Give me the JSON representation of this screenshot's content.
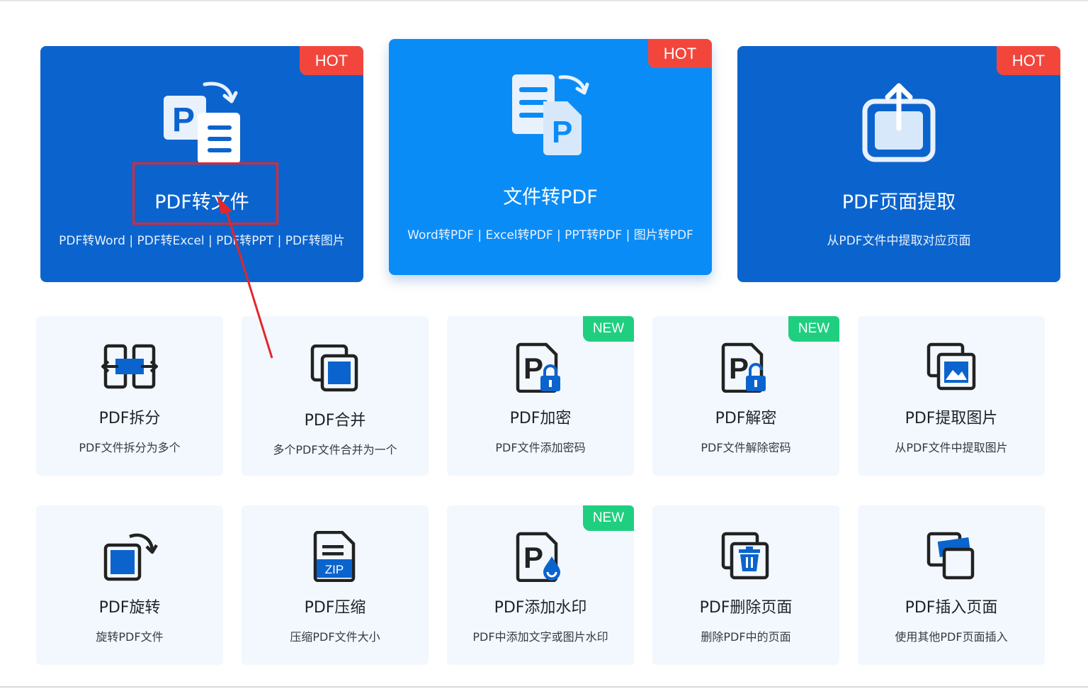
{
  "big_cards": [
    {
      "title": "PDF转文件",
      "subtitle": "PDF转Word | PDF转Excel | PDF转PPT | PDF转图片",
      "badge": "HOT",
      "icon": "pdf-to-file-icon"
    },
    {
      "title": "文件转PDF",
      "subtitle": "Word转PDF | Excel转PDF | PPT转PDF | 图片转PDF",
      "badge": "HOT",
      "icon": "file-to-pdf-icon"
    },
    {
      "title": "PDF页面提取",
      "subtitle": "从PDF文件中提取对应页面",
      "badge": "HOT",
      "icon": "page-extract-icon"
    }
  ],
  "tools_row1": [
    {
      "title": "PDF拆分",
      "subtitle": "PDF文件拆分为多个",
      "icon": "split-icon"
    },
    {
      "title": "PDF合并",
      "subtitle": "多个PDF文件合并为一个",
      "icon": "merge-icon"
    },
    {
      "title": "PDF加密",
      "subtitle": "PDF文件添加密码",
      "badge": "NEW",
      "icon": "lock-icon"
    },
    {
      "title": "PDF解密",
      "subtitle": "PDF文件解除密码",
      "badge": "NEW",
      "icon": "unlock-icon"
    },
    {
      "title": "PDF提取图片",
      "subtitle": "从PDF文件中提取图片",
      "icon": "image-extract-icon"
    }
  ],
  "tools_row2": [
    {
      "title": "PDF旋转",
      "subtitle": "旋转PDF文件",
      "icon": "rotate-icon"
    },
    {
      "title": "PDF压缩",
      "subtitle": "压缩PDF文件大小",
      "icon": "zip-icon",
      "icon_text": "ZIP"
    },
    {
      "title": "PDF添加水印",
      "subtitle": "PDF中添加文字或图片水印",
      "badge": "NEW",
      "icon": "watermark-icon"
    },
    {
      "title": "PDF删除页面",
      "subtitle": "删除PDF中的页面",
      "icon": "trash-icon"
    },
    {
      "title": "PDF插入页面",
      "subtitle": "使用其他PDF页面插入",
      "icon": "insert-page-icon"
    }
  ],
  "colors": {
    "card_blue": "#0b64cd",
    "card_blue_active": "#0a8cf7",
    "hot": "#f2463c",
    "new": "#1fcf7f",
    "small_bg": "#f2f8fd",
    "annotation": "#e3262b",
    "icon_blue": "#0b64cd"
  }
}
